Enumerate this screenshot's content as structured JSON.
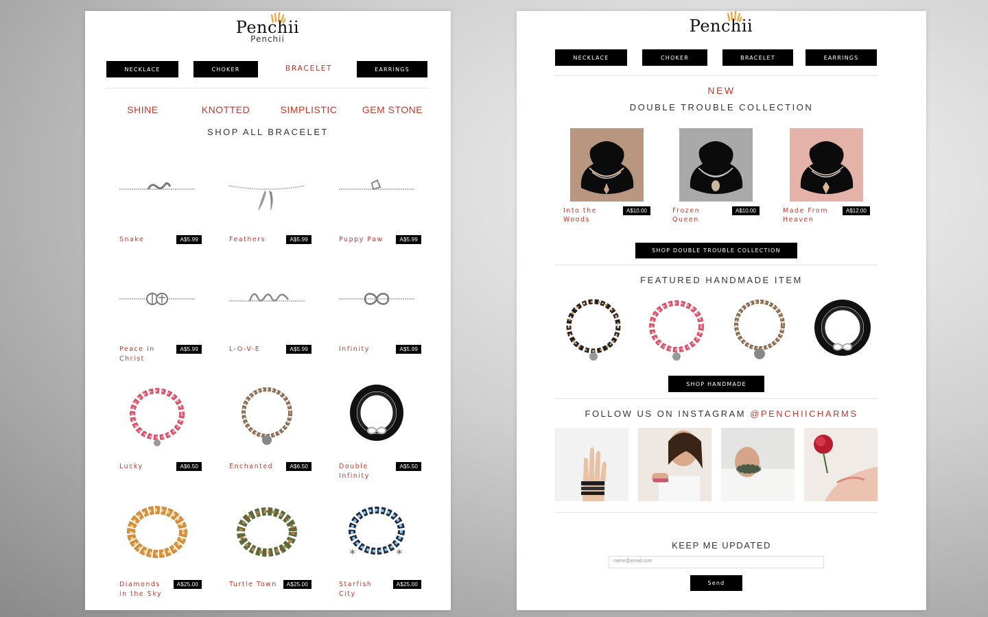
{
  "brand": {
    "name": "Penchii",
    "subtitle": "Penchii"
  },
  "left_page": {
    "nav": [
      {
        "label": "NECKLACE",
        "active": false
      },
      {
        "label": "CHOKER",
        "active": false
      },
      {
        "label": "BRACELET",
        "active": true
      },
      {
        "label": "EARRINGS",
        "active": false
      }
    ],
    "subcategories": [
      "SHINE",
      "KNOTTED",
      "SIMPLISTIC",
      "GEM STONE"
    ],
    "heading": "SHOP ALL BRACELET",
    "products": [
      {
        "name": "Snake",
        "price": "A$5.99",
        "icon": "snake-chain-bracelet-icon"
      },
      {
        "name": "Feathers",
        "price": "A$5.99",
        "icon": "feather-chain-bracelet-icon"
      },
      {
        "name": "Puppy Paw",
        "price": "A$5.99",
        "icon": "paw-chain-bracelet-icon"
      },
      {
        "name": "Peace in Christ",
        "price": "A$5.99",
        "icon": "peace-chain-bracelet-icon"
      },
      {
        "name": "L-O-V-E",
        "price": "A$5.99",
        "icon": "love-chain-bracelet-icon"
      },
      {
        "name": "Infinity",
        "price": "A$5.99",
        "icon": "infinity-chain-bracelet-icon"
      },
      {
        "name": "Lucky",
        "price": "A$6.50",
        "icon": "pink-braided-bracelet-icon"
      },
      {
        "name": "Enchanted",
        "price": "A$6.50",
        "icon": "brown-leather-bracelet-icon"
      },
      {
        "name": "Double Infinity",
        "price": "A$5.50",
        "icon": "black-cord-bracelet-icon"
      },
      {
        "name": "Diamonds in the Sky",
        "price": "A$25.00",
        "icon": "gold-beaded-bracelet-icon"
      },
      {
        "name": "Turtle Town",
        "price": "A$25.00",
        "icon": "camo-beaded-bracelet-icon"
      },
      {
        "name": "Starfish City",
        "price": "A$25.00",
        "icon": "blue-starfish-bracelet-icon"
      }
    ]
  },
  "right_page": {
    "nav": [
      {
        "label": "NECKLACE"
      },
      {
        "label": "CHOKER"
      },
      {
        "label": "BRACELET"
      },
      {
        "label": "EARRINGS"
      }
    ],
    "new_label": "NEW",
    "collection_title": "DOUBLE TROUBLE COLLECTION",
    "collection": [
      {
        "name": "Into the Woods",
        "price": "A$10.00",
        "bg": "#b99680"
      },
      {
        "name": "Frozen Queen",
        "price": "A$10.00",
        "bg": "#a9a9a9"
      },
      {
        "name": "Made From Heaven",
        "price": "A$12.00",
        "bg": "#e4b2a8"
      }
    ],
    "collection_cta": "SHOP DOUBLE TROUBLE COLLECTION",
    "featured_title": "FEATURED HANDMADE ITEM",
    "featured_cta": "SHOP HANDMADE",
    "instagram_prefix": "FOLLOW US ON INSTAGRAM",
    "instagram_handle": "@PENCHIICHARMS",
    "newsletter_title": "KEEP ME UPDATED",
    "email_placeholder": "name@email.com",
    "send_label": "Send"
  },
  "colors": {
    "accent": "#c0392b",
    "button": "#000000",
    "logo_rays": "#f0a030"
  }
}
